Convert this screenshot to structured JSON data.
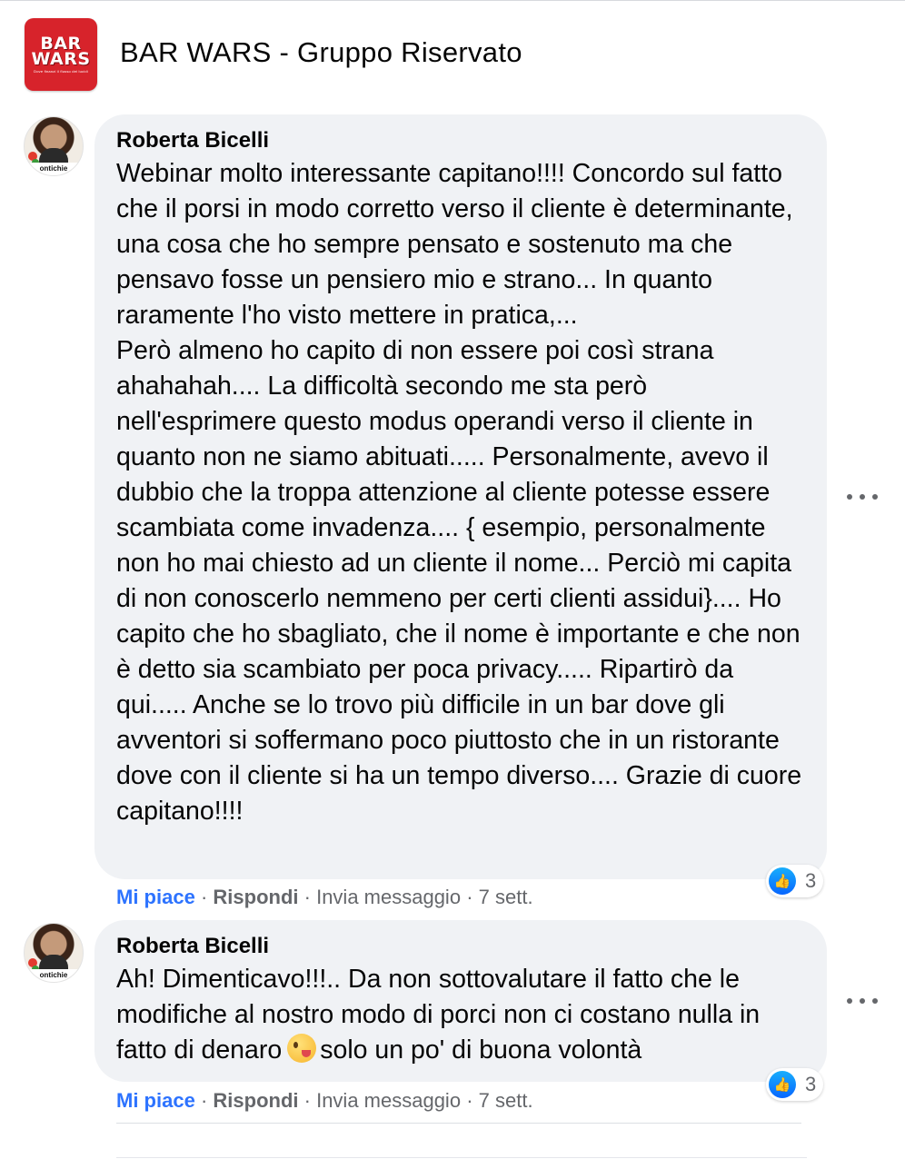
{
  "group": {
    "name": "BAR WARS - Gruppo Riservato",
    "logo_line1": "BAR",
    "logo_line2": "WARS",
    "logo_tagline": "Dove finanzi il flusso dei lucidi"
  },
  "comments": [
    {
      "author": "Roberta Bicelli",
      "avatar_tag": "ontichie",
      "text": "Webinar molto interessante capitano!!!! Concordo sul fatto che il porsi in modo corretto verso il cliente è determinante, una cosa che ho sempre pensato e sostenuto ma che pensavo fosse un pensiero mio e strano... In quanto raramente l'ho visto mettere in pratica,...\nPerò almeno ho capito di non essere poi così strana ahahahah.... La difficoltà secondo me sta però nell'esprimere questo modus operandi verso il cliente in quanto non ne siamo abituati..... Personalmente, avevo il dubbio che la troppa attenzione al cliente potesse essere scambiata come invadenza.... { esempio, personalmente non ho mai chiesto ad un cliente il nome... Perciò mi capita di non conoscerlo nemmeno per certi clienti assidui}.... Ho capito che ho sbagliato, che il nome è importante e che non è detto sia scambiato per poca privacy..... Ripartirò da qui..... Anche se lo trovo più difficile in un bar dove gli avventori si soffermano poco piuttosto che in un ristorante dove con il cliente si ha un tempo diverso.... Grazie di cuore capitano!!!!",
      "reaction_count": "3",
      "actions": {
        "like": "Mi piace",
        "reply": "Rispondi",
        "message": "Invia messaggio",
        "time": "7 sett."
      }
    },
    {
      "author": "Roberta Bicelli",
      "avatar_tag": "ontichie",
      "text_before_emoji": "Ah! Dimenticavo!!!.. Da non sottovalutare il fatto che le modifiche al nostro modo di porci non ci costano nulla in fatto di denaro",
      "emoji": "winking-tongue-emoji",
      "text_after_emoji": "solo un po' di buona volontà",
      "reaction_count": "3",
      "actions": {
        "like": "Mi piace",
        "reply": "Rispondi",
        "message": "Invia messaggio",
        "time": "7 sett."
      }
    }
  ],
  "colors": {
    "bubble": "#f0f2f5",
    "like_blue": "#2d73ff",
    "muted": "#65676b",
    "logo_red": "#d7232b"
  }
}
